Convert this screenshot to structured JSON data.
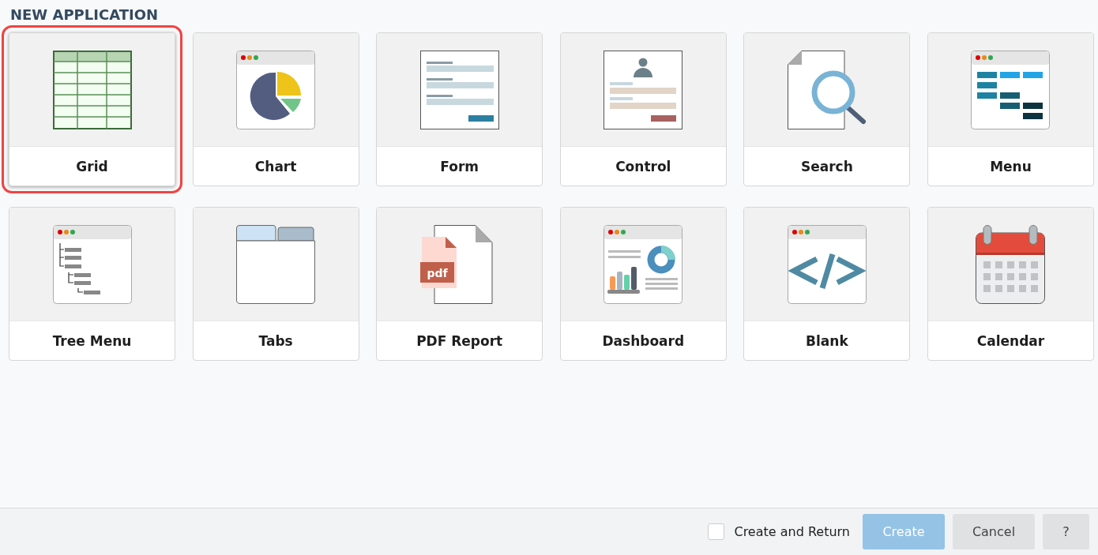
{
  "title": "NEW APPLICATION",
  "templates": [
    {
      "kind": "grid",
      "label": "Grid",
      "selected": true
    },
    {
      "kind": "chart",
      "label": "Chart",
      "selected": false
    },
    {
      "kind": "form",
      "label": "Form",
      "selected": false
    },
    {
      "kind": "control",
      "label": "Control",
      "selected": false
    },
    {
      "kind": "search",
      "label": "Search",
      "selected": false
    },
    {
      "kind": "menu",
      "label": "Menu",
      "selected": false
    },
    {
      "kind": "tree",
      "label": "Tree Menu",
      "selected": false
    },
    {
      "kind": "tabs",
      "label": "Tabs",
      "selected": false
    },
    {
      "kind": "pdf",
      "label": "PDF Report",
      "selected": false
    },
    {
      "kind": "dashboard",
      "label": "Dashboard",
      "selected": false
    },
    {
      "kind": "blank",
      "label": "Blank",
      "selected": false
    },
    {
      "kind": "calendar",
      "label": "Calendar",
      "selected": false
    }
  ],
  "footer": {
    "checkbox": {
      "label": "Create and Return",
      "checked": false
    },
    "buttons": [
      {
        "kind": "primary",
        "label": "Create",
        "disabled": true
      },
      {
        "kind": "secondary",
        "label": "Cancel",
        "disabled": false
      },
      {
        "kind": "help",
        "label": "?",
        "disabled": false
      }
    ]
  }
}
